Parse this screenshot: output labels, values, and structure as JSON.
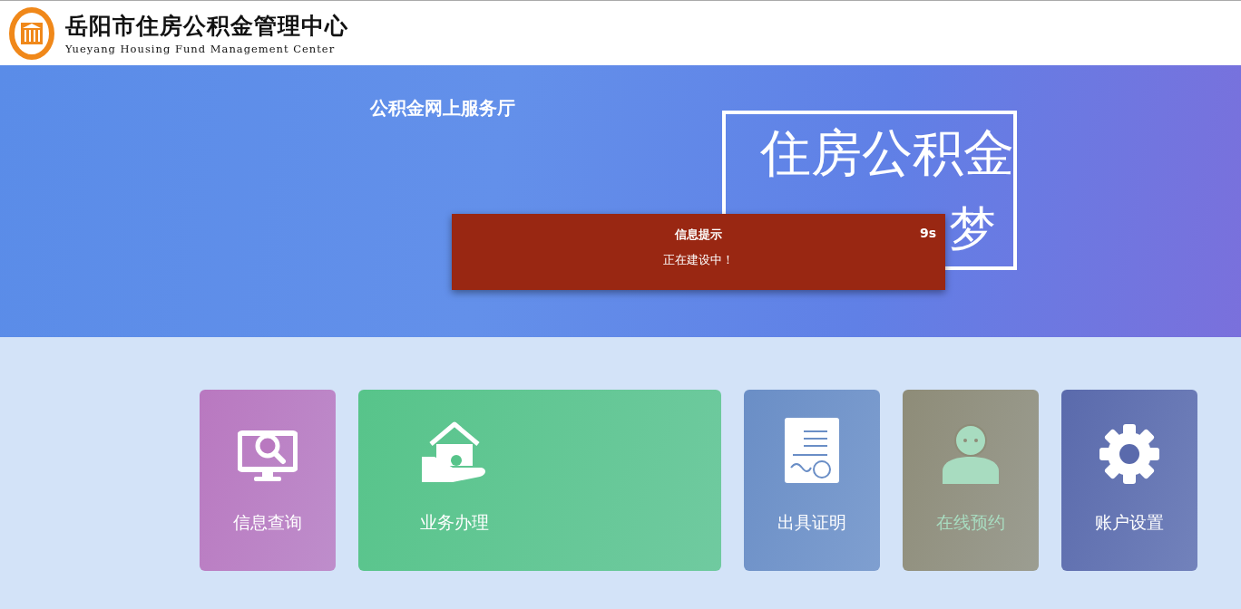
{
  "header": {
    "title": "岳阳市住房公积金管理中心",
    "subtitle": "Yueyang Housing Fund Management Center"
  },
  "banner": {
    "hall_title": "公积金网上服务厅",
    "slogan_line_1": "住房公积金",
    "slogan_line_2": "梦"
  },
  "toast": {
    "title": "信息提示",
    "countdown": "9s",
    "message": "正在建设中！"
  },
  "tiles": [
    {
      "label": "信息查询",
      "color": "#b978c0",
      "wide": false,
      "highlighted": false
    },
    {
      "label": "业务办理",
      "color": "#57c48a",
      "wide": true,
      "highlighted": false
    },
    {
      "label": "出具证明",
      "color": "#6a8ec6",
      "wide": false,
      "highlighted": false
    },
    {
      "label": "在线预约",
      "color": "#8e8c78",
      "wide": false,
      "highlighted": true
    },
    {
      "label": "账户设置",
      "color": "#5a6aac",
      "wide": false,
      "highlighted": false
    }
  ]
}
